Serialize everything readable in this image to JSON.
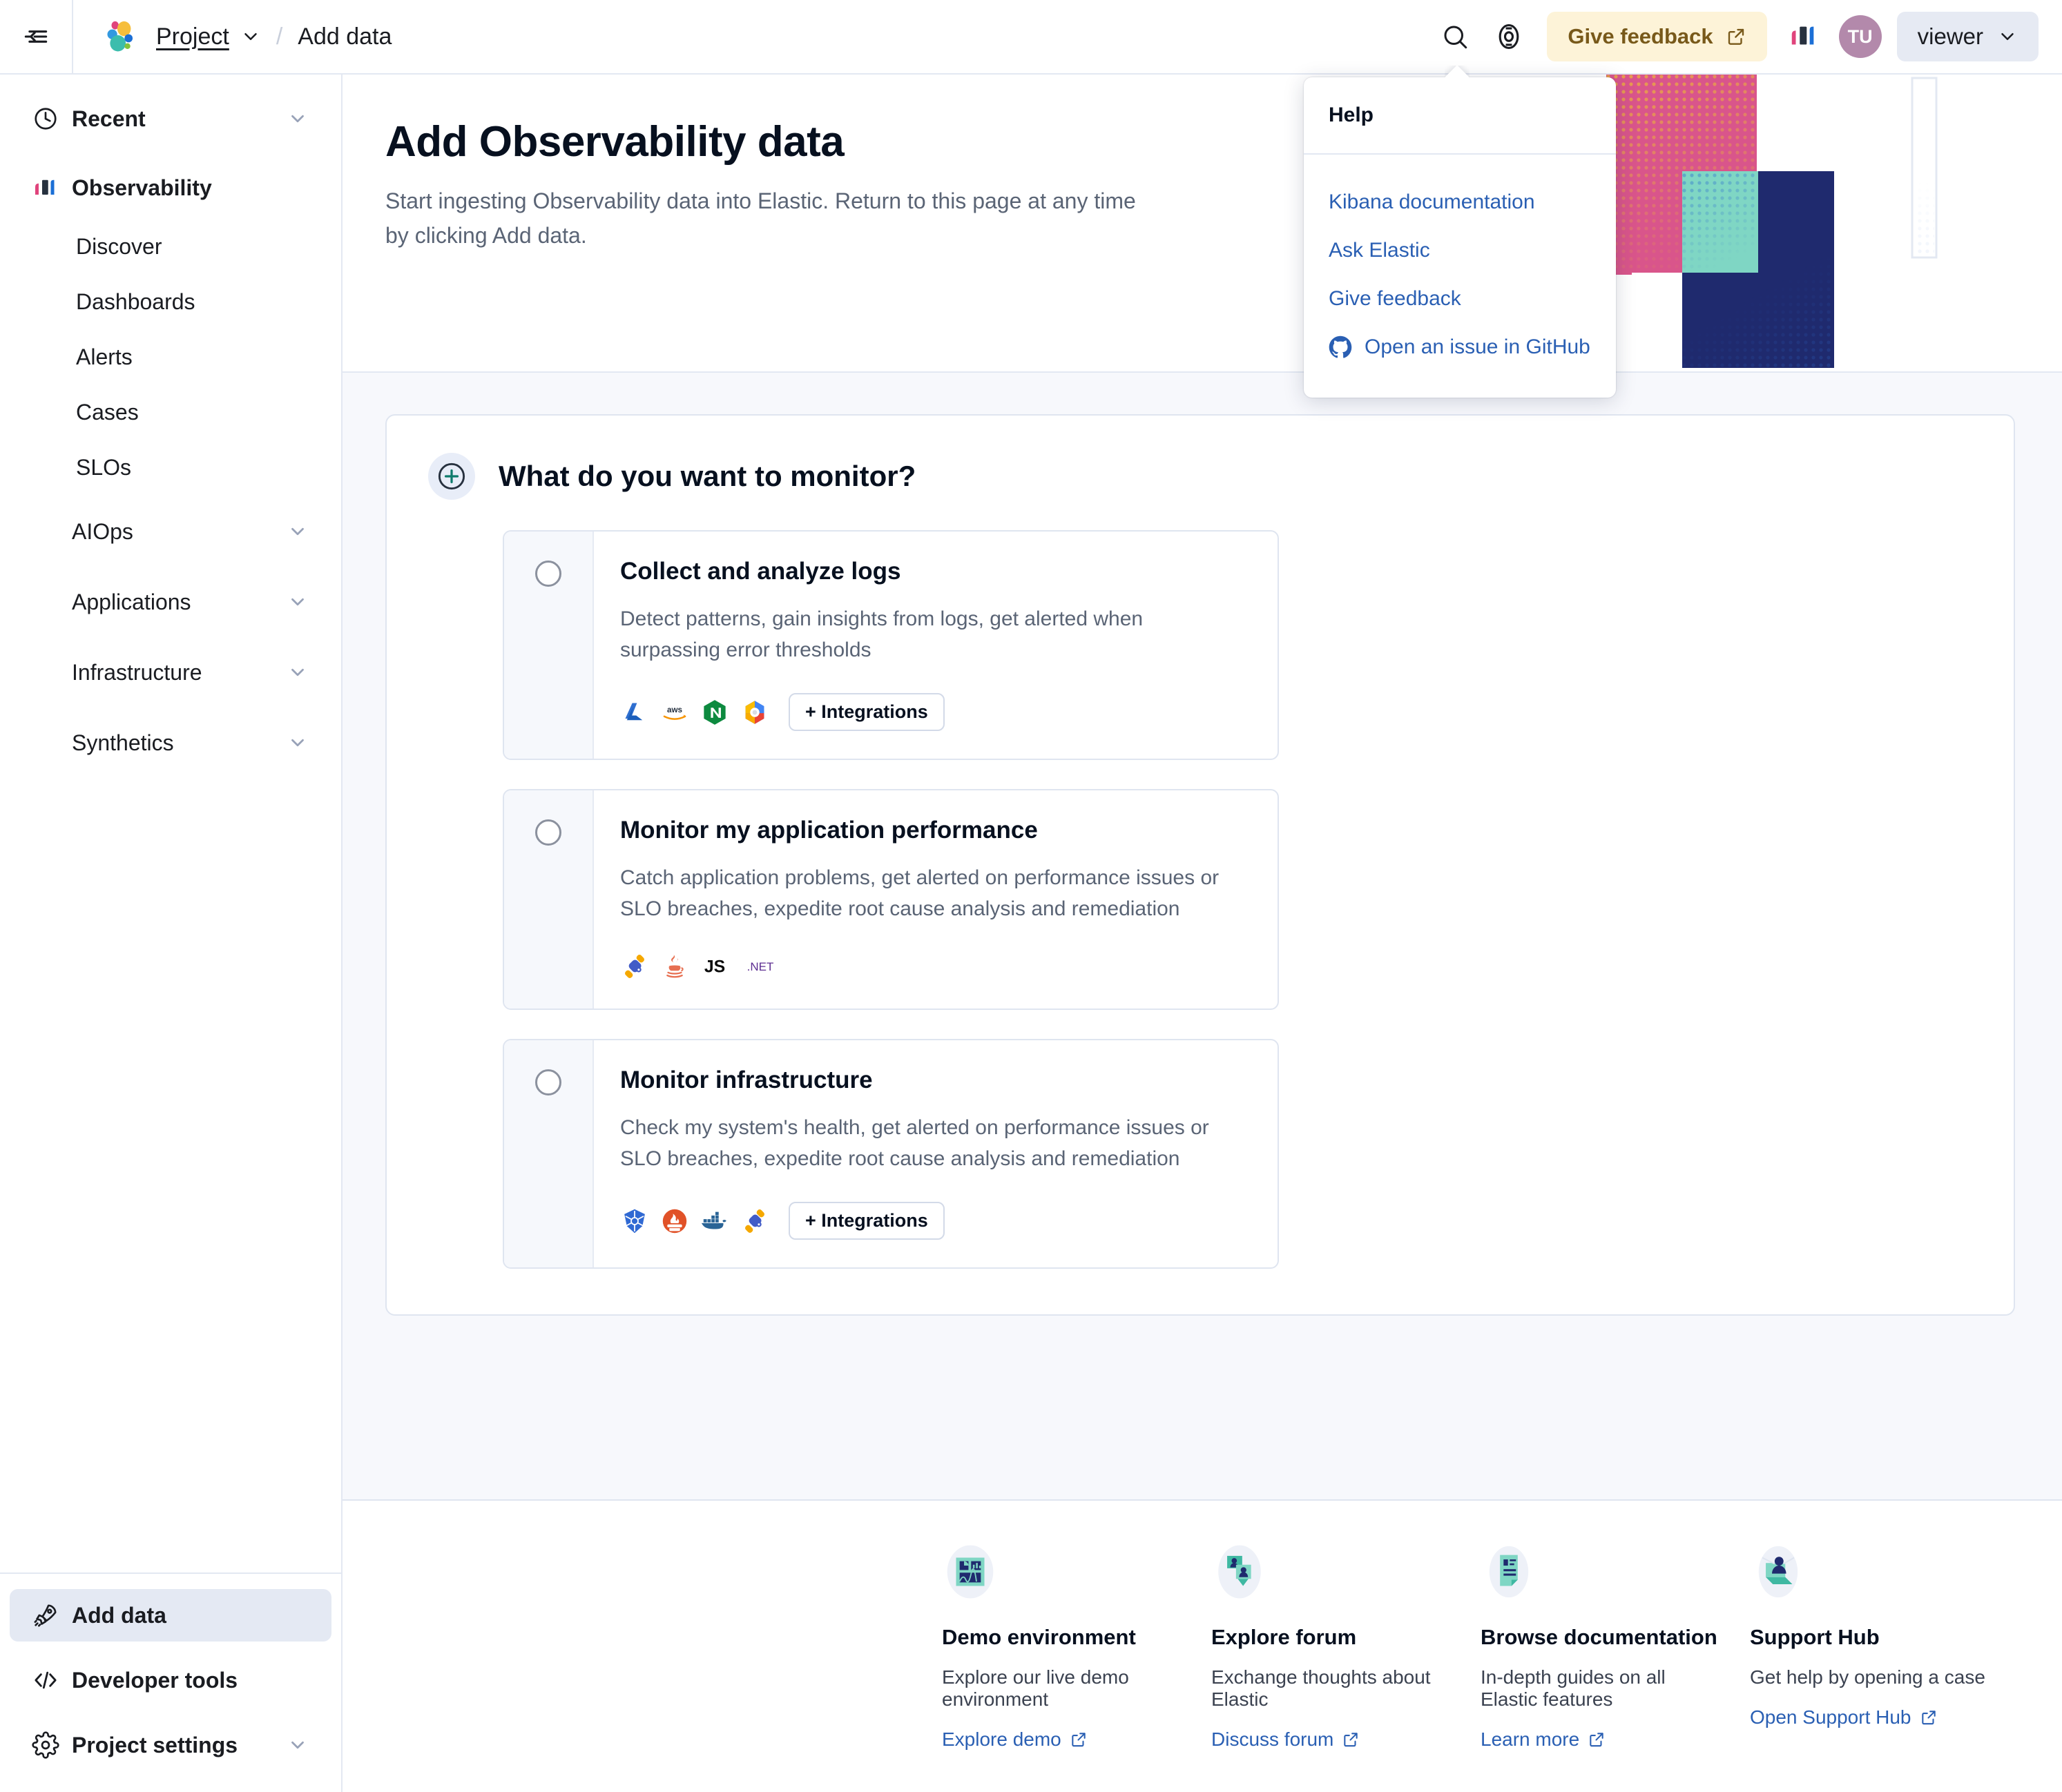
{
  "topbar": {
    "collapse_icon": "collapse-nav-icon",
    "logo_icon": "elastic-logo-icon",
    "project_label": "Project",
    "separator": "/",
    "current_crumb": "Add data",
    "search_icon": "search-icon",
    "help_icon": "help-lifebuoy-icon",
    "feedback_label": "Give feedback",
    "external_icon": "external-link-icon",
    "observability_icon": "observability-logo-icon",
    "avatar_initials": "TU",
    "space_label": "viewer",
    "space_caret_icon": "chevron-down-icon"
  },
  "help_popover": {
    "title": "Help",
    "items": [
      {
        "label": "Kibana documentation",
        "icon": ""
      },
      {
        "label": "Ask Elastic",
        "icon": ""
      },
      {
        "label": "Give feedback",
        "icon": ""
      },
      {
        "label": "Open an issue in GitHub",
        "icon": "github-icon"
      }
    ]
  },
  "sidebar": {
    "recent": {
      "label": "Recent",
      "icon": "clock-icon",
      "caret": "chevron-down-icon"
    },
    "solution": {
      "label": "Observability",
      "icon": "observability-logo-icon"
    },
    "links": [
      "Discover",
      "Dashboards",
      "Alerts",
      "Cases",
      "SLOs"
    ],
    "groups": [
      {
        "label": "AIOps",
        "caret": "chevron-down-icon"
      },
      {
        "label": "Applications",
        "caret": "chevron-down-icon"
      },
      {
        "label": "Infrastructure",
        "caret": "chevron-down-icon"
      },
      {
        "label": "Synthetics",
        "caret": "chevron-down-icon"
      }
    ],
    "bottom": [
      {
        "label": "Add data",
        "icon": "rocket-icon",
        "active": true,
        "caret": false
      },
      {
        "label": "Developer tools",
        "icon": "code-icon",
        "active": false,
        "caret": false
      },
      {
        "label": "Project settings",
        "icon": "gear-icon",
        "active": false,
        "caret": true
      }
    ]
  },
  "main": {
    "title": "Add Observability data",
    "subtitle": "Start ingesting Observability data into Elastic. Return to this page at any time by clicking Add data.",
    "panel_title": "What do you want to monitor?",
    "panel_icon": "plus-circle-icon",
    "options": [
      {
        "title": "Collect and analyze logs",
        "description": "Detect patterns, gain insights from logs, get alerted when surpassing error thresholds",
        "icons": [
          "azure-icon",
          "aws-icon",
          "nginx-icon",
          "google-cloud-icon"
        ],
        "integrations_label": "+ Integrations",
        "selected": false
      },
      {
        "title": "Monitor my application performance",
        "description": "Catch application problems, get alerted on performance issues or SLO breaches, expedite root cause analysis and remediation",
        "icons": [
          "opentelemetry-icon",
          "java-icon",
          "javascript-icon",
          "dotnet-icon"
        ],
        "integrations_label": "",
        "selected": false
      },
      {
        "title": "Monitor infrastructure",
        "description": "Check my system's health, get alerted on performance issues or SLO breaches, expedite root cause analysis and remediation",
        "icons": [
          "kubernetes-icon",
          "prometheus-icon",
          "docker-icon",
          "opentelemetry-icon"
        ],
        "integrations_label": "+ Integrations",
        "selected": false
      }
    ]
  },
  "footer": {
    "cards": [
      {
        "title": "Demo environment",
        "description": "Explore our live demo environment",
        "link": "Explore demo",
        "icon": "demo-dashboard-icon"
      },
      {
        "title": "Explore forum",
        "description": "Exchange thoughts about Elastic",
        "link": "Discuss forum",
        "icon": "forum-people-icon"
      },
      {
        "title": "Browse documentation",
        "description": "In-depth guides on all Elastic features",
        "link": "Learn more",
        "icon": "document-icon"
      },
      {
        "title": "Support Hub",
        "description": "Get help by opening a case",
        "link": "Open Support Hub",
        "icon": "support-person-icon"
      }
    ]
  },
  "colors": {
    "link": "#2a5fb3",
    "feedback_bg": "#fdf3d8",
    "feedback_fg": "#78591a",
    "avatar_bg": "#b389ab",
    "panel_bg": "#f7f8fc",
    "border": "#dfe5f0",
    "art_pink": "#d9558b",
    "art_navy": "#1f2a6e",
    "art_teal": "#7fd6c4",
    "art_orange": "#e8a04b",
    "art_blue": "#2f6fd0"
  }
}
